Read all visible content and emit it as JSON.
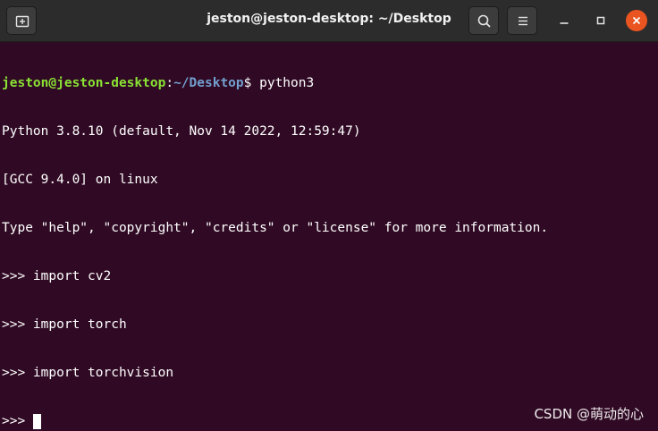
{
  "window": {
    "title": "jeston@jeston-desktop: ~/Desktop",
    "icons": {
      "new_tab": "new-tab-icon",
      "search": "search-icon",
      "menu": "hamburger-menu-icon",
      "minimize": "minimize-icon",
      "maximize": "maximize-icon",
      "close": "close-icon"
    }
  },
  "terminal": {
    "prompt_user_host": "jeston@jeston-desktop",
    "prompt_colon": ":",
    "prompt_path": "~/Desktop",
    "prompt_symbol": "$ ",
    "command": "python3",
    "output_lines": [
      "Python 3.8.10 (default, Nov 14 2022, 12:59:47)",
      "[GCC 9.4.0] on linux",
      "Type \"help\", \"copyright\", \"credits\" or \"license\" for more information."
    ],
    "repl_lines": [
      ">>> import cv2",
      ">>> import torch",
      ">>> import torchvision"
    ],
    "current_prompt": ">>> "
  },
  "colors": {
    "terminal_bg": "#300a24",
    "titlebar_bg": "#2c2c2c",
    "prompt_user": "#8ae234",
    "prompt_path": "#729fcf",
    "close_button": "#e95420"
  },
  "watermark": "CSDN @萌动的心"
}
